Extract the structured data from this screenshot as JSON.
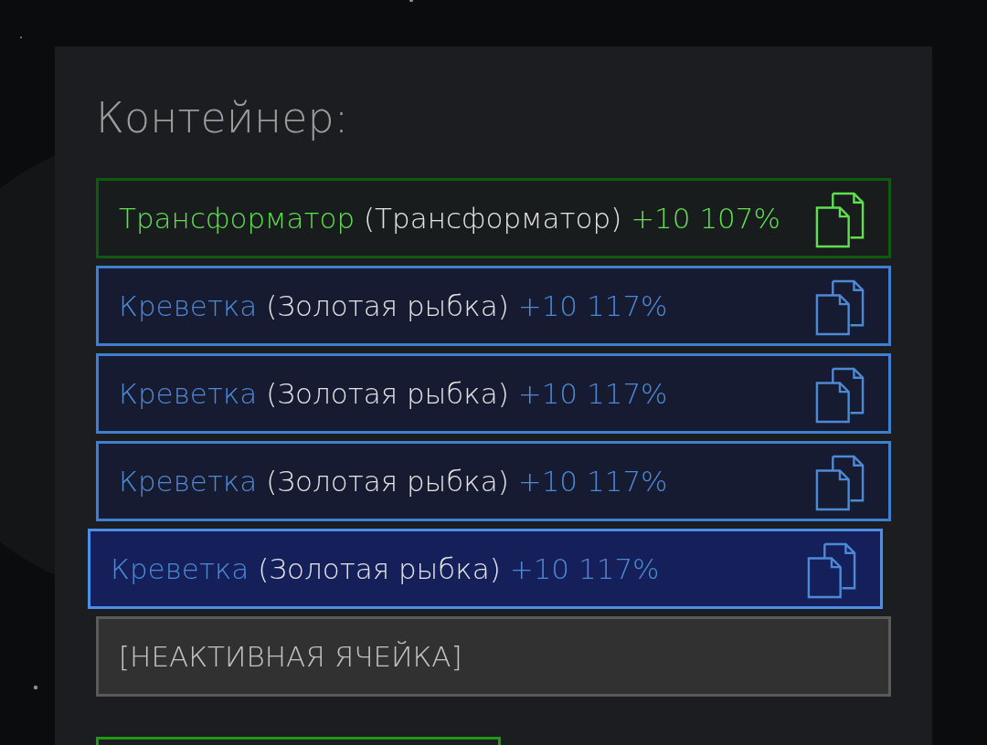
{
  "title": "Контейнер:",
  "slots": [
    {
      "kind": "green",
      "name": "Трансформатор",
      "item": "(Трансформатор)",
      "bonus": "+10 107%",
      "hovered": false
    },
    {
      "kind": "blue",
      "name": "Креветка",
      "item": "(Золотая рыбка)",
      "bonus": "+10 117%",
      "hovered": false
    },
    {
      "kind": "blue",
      "name": "Креветка",
      "item": "(Золотая рыбка)",
      "bonus": "+10 117%",
      "hovered": false
    },
    {
      "kind": "blue",
      "name": "Креветка",
      "item": "(Золотая рыбка)",
      "bonus": "+10 117%",
      "hovered": false
    },
    {
      "kind": "blue",
      "name": "Креветка",
      "item": "(Золотая рыбка)",
      "bonus": "+10 117%",
      "hovered": true
    },
    {
      "kind": "inactive",
      "label": "[НЕАКТИВНАЯ ЯЧЕЙКА]"
    }
  ]
}
